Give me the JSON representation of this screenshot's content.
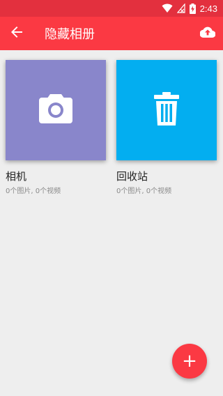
{
  "status_bar": {
    "time": "2:43",
    "icons": [
      "wifi-icon",
      "no-signal-icon",
      "battery-charging-icon"
    ]
  },
  "app_bar": {
    "title": "隐藏相册",
    "back_icon": "arrow-back-icon",
    "upload_icon": "cloud-upload-icon",
    "color": "#fb3943"
  },
  "albums": [
    {
      "name": "相机",
      "count": "0个图片, 0个视频",
      "icon": "camera-icon",
      "color": "#8986cb"
    },
    {
      "name": "回收站",
      "count": "0个图片, 0个视频",
      "icon": "trash-icon",
      "color": "#03aef0"
    }
  ],
  "fab": {
    "label": "+",
    "color": "#fb3943"
  }
}
